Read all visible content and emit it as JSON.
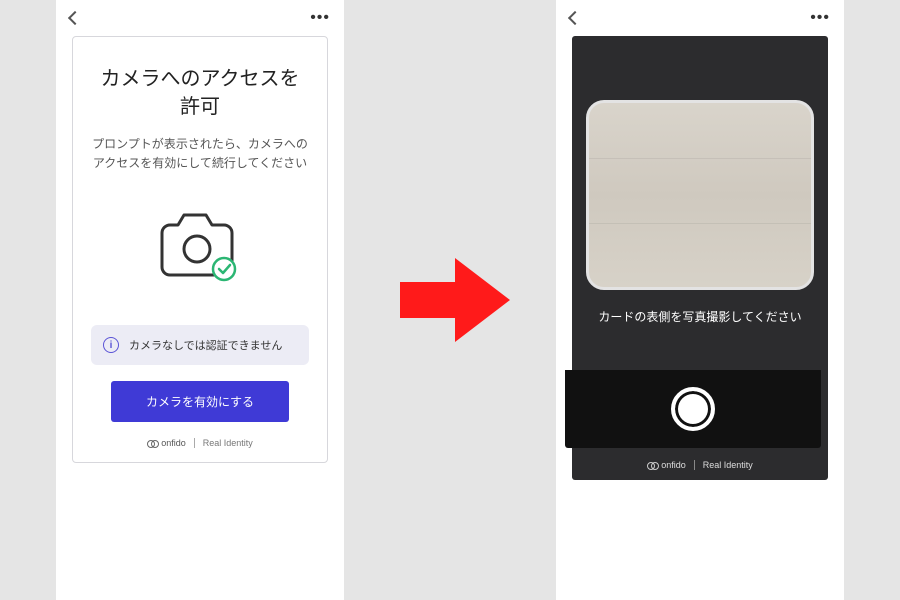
{
  "left": {
    "title": "カメラへのアクセスを許可",
    "subtitle": "プロンプトが表示されたら、カメラへのアクセスを有効にして続行してください",
    "notice": "カメラなしでは認証できません",
    "button": "カメラを有効にする",
    "footer_brand": "onfido",
    "footer_tag": "Real Identity"
  },
  "right": {
    "instruction": "カードの表側を写真撮影してください",
    "footer_brand": "onfido",
    "footer_tag": "Real Identity"
  }
}
